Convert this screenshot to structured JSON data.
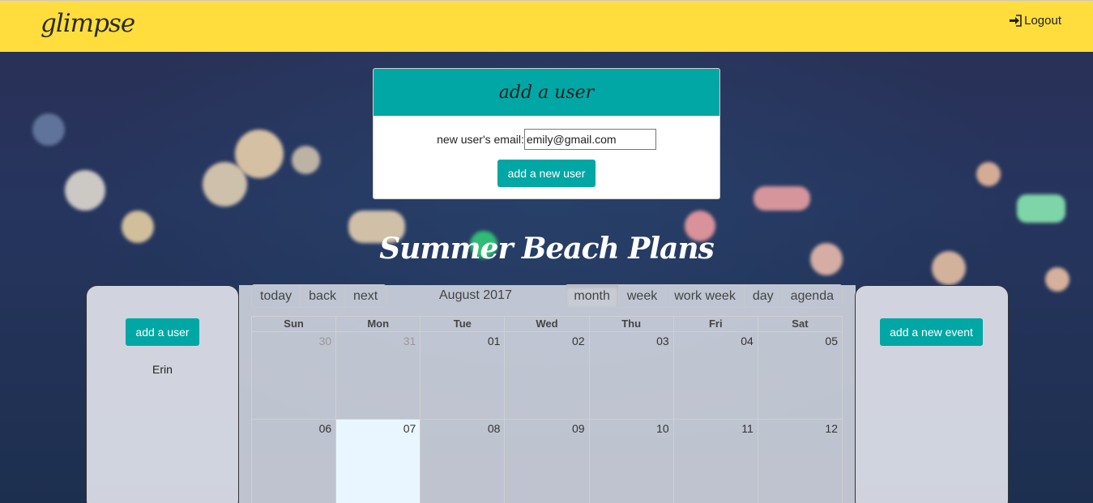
{
  "app": {
    "logo": "glimpse",
    "logout_label": "Logout"
  },
  "add_user_card": {
    "title": "add a user",
    "email_label": "new user's email:",
    "email_value": "emily@gmail.com",
    "submit_label": "add a new user"
  },
  "calendar_title": "Summer Beach Plans",
  "left_panel": {
    "button_label": "add a user",
    "users": [
      "Erin"
    ]
  },
  "right_panel": {
    "button_label": "add a new event"
  },
  "toolbar": {
    "nav": [
      "today",
      "back",
      "next"
    ],
    "label": "August 2017",
    "views": [
      "month",
      "week",
      "work week",
      "day",
      "agenda"
    ],
    "active_view": "month"
  },
  "weekdays": [
    "Sun",
    "Mon",
    "Tue",
    "Wed",
    "Thu",
    "Fri",
    "Sat"
  ],
  "weeks": [
    [
      "30",
      "31",
      "01",
      "02",
      "03",
      "04",
      "05"
    ],
    [
      "06",
      "07",
      "08",
      "09",
      "10",
      "11",
      "12"
    ]
  ],
  "colors": {
    "topbar": "#fedd3d",
    "accent": "#00a7a5",
    "today": "#eaf6ff"
  }
}
